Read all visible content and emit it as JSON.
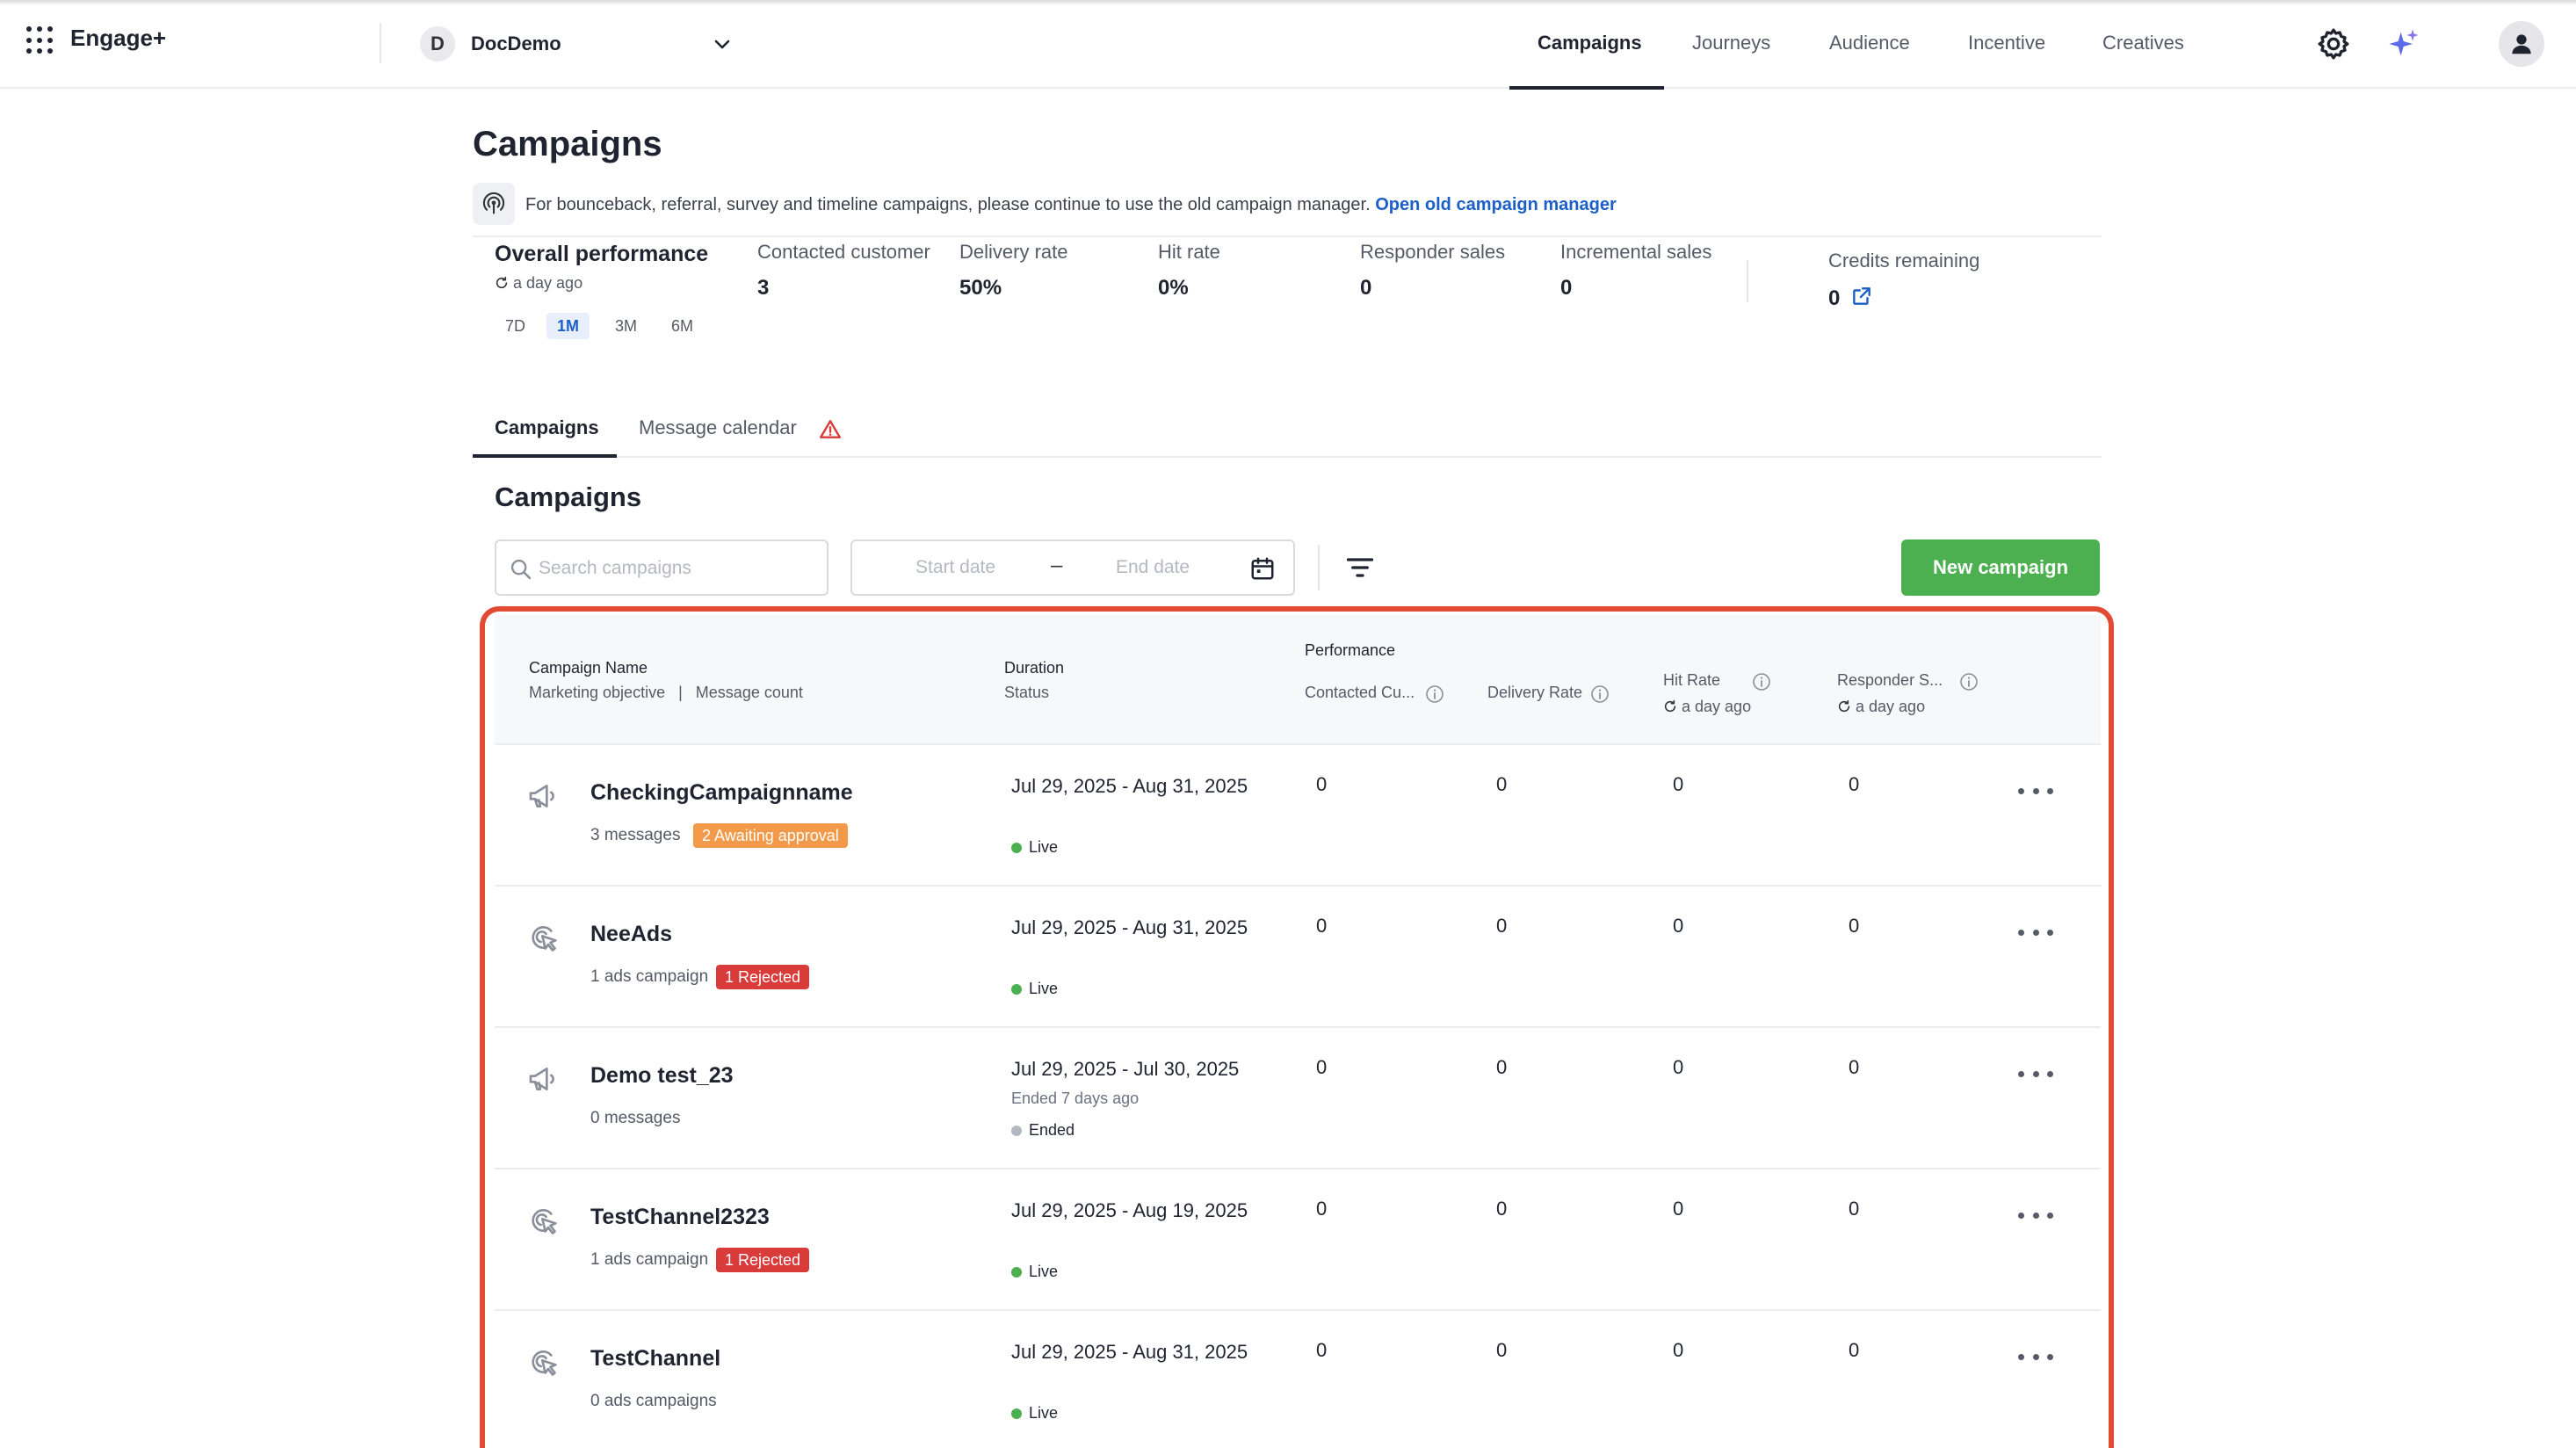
{
  "app": {
    "brand": "Engage+",
    "org_initial": "D",
    "org_name": "DocDemo",
    "nav": [
      "Campaigns",
      "Journeys",
      "Audience",
      "Incentive",
      "Creatives"
    ]
  },
  "page": {
    "title": "Campaigns",
    "info_text": "For bounceback, referral, survey and timeline campaigns, please continue to use the old campaign manager.",
    "info_link": "Open old campaign manager"
  },
  "performance": {
    "title": "Overall performance",
    "updated": "a day ago",
    "ranges": [
      "7D",
      "1M",
      "3M",
      "6M"
    ],
    "active_range": "1M",
    "metrics": [
      {
        "label": "Contacted customer",
        "value": "3"
      },
      {
        "label": "Delivery rate",
        "value": "50%"
      },
      {
        "label": "Hit rate",
        "value": "0%"
      },
      {
        "label": "Responder sales",
        "value": "0"
      },
      {
        "label": "Incremental sales",
        "value": "0"
      }
    ],
    "credits_label": "Credits remaining",
    "credits_value": "0"
  },
  "tabs": [
    "Campaigns",
    "Message calendar"
  ],
  "section_title": "Campaigns",
  "toolbar": {
    "search_placeholder": "Search campaigns",
    "start_date_placeholder": "Start date",
    "date_separator": "–",
    "end_date_placeholder": "End date",
    "new_campaign_label": "New campaign"
  },
  "table": {
    "headers": {
      "name": "Campaign Name",
      "name_sub_a": "Marketing objective",
      "name_sep": "|",
      "name_sub_b": "Message count",
      "duration": "Duration",
      "duration_sub": "Status",
      "performance": "Performance",
      "contacted": "Contacted Cu...",
      "delivery": "Delivery Rate",
      "hit": "Hit Rate",
      "hit_sub": "a day ago",
      "responder": "Responder S...",
      "responder_sub": "a day ago"
    },
    "rows": [
      {
        "icon": "megaphone-icon",
        "name": "CheckingCampaignname",
        "sub": "3 messages",
        "badge": "2 Awaiting approval",
        "badge_color": "#f2994a",
        "dates": "Jul 29, 2025 - Aug 31, 2025",
        "ended_sub": "",
        "status": "Live",
        "contacted": "0",
        "delivery": "0",
        "hit": "0",
        "responder": "0"
      },
      {
        "icon": "ads-cursor-icon",
        "name": "NeeAds",
        "sub": "1 ads campaign",
        "badge": "1 Rejected",
        "badge_color": "#d93a3a",
        "dates": "Jul 29, 2025 - Aug 31, 2025",
        "ended_sub": "",
        "status": "Live",
        "contacted": "0",
        "delivery": "0",
        "hit": "0",
        "responder": "0"
      },
      {
        "icon": "megaphone-icon",
        "name": "Demo test_23",
        "sub": "0 messages",
        "badge": "",
        "badge_color": "",
        "dates": "Jul 29, 2025 - Jul 30, 2025",
        "ended_sub": "Ended 7 days ago",
        "status": "Ended",
        "contacted": "0",
        "delivery": "0",
        "hit": "0",
        "responder": "0"
      },
      {
        "icon": "ads-cursor-icon",
        "name": "TestChannel2323",
        "sub": "1 ads campaign",
        "badge": "1 Rejected",
        "badge_color": "#d93a3a",
        "dates": "Jul 29, 2025 - Aug 19, 2025",
        "ended_sub": "",
        "status": "Live",
        "contacted": "0",
        "delivery": "0",
        "hit": "0",
        "responder": "0"
      },
      {
        "icon": "ads-cursor-icon",
        "name": "TestChannel",
        "sub": "0 ads campaigns",
        "badge": "",
        "badge_color": "",
        "dates": "Jul 29, 2025 - Aug 31, 2025",
        "ended_sub": "",
        "status": "Live",
        "contacted": "0",
        "delivery": "0",
        "hit": "0",
        "responder": "0"
      }
    ]
  },
  "colors": {
    "accent": "#1c5fc8",
    "primary_button": "#4caf50",
    "highlight_border": "#e34a33",
    "live": "#4caf50",
    "ended": "#b4b8c0"
  }
}
